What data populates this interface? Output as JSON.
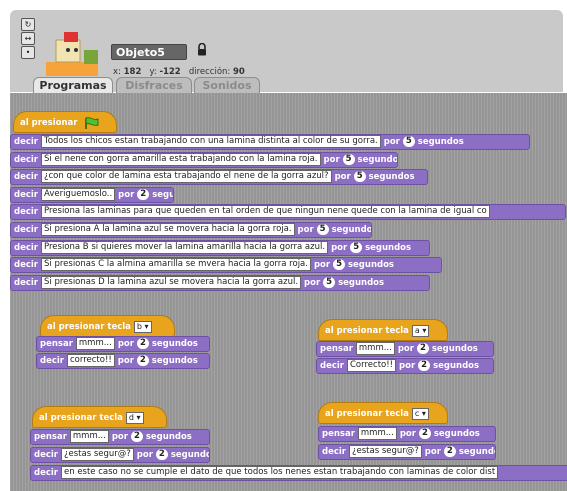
{
  "header": {
    "object_name": "Objeto5",
    "x_label": "x:",
    "x_value": "182",
    "y_label": "y:",
    "y_value": "-122",
    "direction_label": "dirección:",
    "direction_value": "90"
  },
  "tabs": [
    "Programas",
    "Disfraces",
    "Sonidos"
  ],
  "script_main": {
    "hat_label": "al presionar",
    "blocks": [
      {
        "cmd": "decir",
        "text": "Todos los chicos estan trabajando con una lamina distinta al color de su gorra.",
        "por": "por",
        "secs": "5",
        "unit": "segundos"
      },
      {
        "cmd": "decir",
        "text": "Si el nene con gorra amarilla esta trabajando con la lamina roja.",
        "por": "por",
        "secs": "5",
        "unit": "segundos"
      },
      {
        "cmd": "decir",
        "text": "¿con que color de lamina esta trabajando el nene de la gorra azul?",
        "por": "por",
        "secs": "5",
        "unit": "segundos"
      },
      {
        "cmd": "decir",
        "text": "Averiguemoslo..",
        "por": "por",
        "secs": "2",
        "unit": "segundos"
      },
      {
        "cmd": "decir",
        "text": "Presiona las laminas para que queden en tal orden de que ningun nene quede con la lamina de igual co",
        "por": "",
        "secs": "",
        "unit": ""
      },
      {
        "cmd": "decir",
        "text": "Si presiona A la lamina azul se movera hacia la gorra roja.",
        "por": "por",
        "secs": "5",
        "unit": "segundos"
      },
      {
        "cmd": "decir",
        "text": "Presiona B si quieres mover la lamina amarilla hacia la gorra azul.",
        "por": "por",
        "secs": "5",
        "unit": "segundos"
      },
      {
        "cmd": "decir",
        "text": "Si presionas C la almina amarilla se mvera hacia la gorra roja.",
        "por": "por",
        "secs": "5",
        "unit": "segundos"
      },
      {
        "cmd": "decir",
        "text": "Si presionas D la lamina azul se movera hacia la gorra azul.",
        "por": "por",
        "secs": "5",
        "unit": "segundos"
      }
    ]
  },
  "script_b": {
    "hat_label": "al presionar tecla",
    "key": "b",
    "think": {
      "cmd": "pensar",
      "text": "mmm...",
      "por": "por",
      "secs": "2",
      "unit": "segundos"
    },
    "say": {
      "cmd": "decir",
      "text": "correcto!!",
      "por": "por",
      "secs": "2",
      "unit": "segundos"
    }
  },
  "script_a": {
    "hat_label": "al presionar tecla",
    "key": "a",
    "think": {
      "cmd": "pensar",
      "text": "mmm...",
      "por": "por",
      "secs": "2",
      "unit": "segundos"
    },
    "say": {
      "cmd": "decir",
      "text": "Correcto!!",
      "por": "por",
      "secs": "2",
      "unit": "segundos"
    }
  },
  "script_d": {
    "hat_label": "al presionar tecla",
    "key": "d",
    "think": {
      "cmd": "pensar",
      "text": "mmm...",
      "por": "por",
      "secs": "2",
      "unit": "segundos"
    },
    "say": {
      "cmd": "decir",
      "text": "¿estas segur@?",
      "por": "por",
      "secs": "2",
      "unit": "segundos"
    },
    "say2": {
      "cmd": "decir",
      "text": "en este caso no se cumple el dato de que todos los nenes estan trabajando con laminas de color dist"
    }
  },
  "script_c": {
    "hat_label": "al presionar tecla",
    "key": "c",
    "think": {
      "cmd": "pensar",
      "text": "mmm...",
      "por": "por",
      "secs": "2",
      "unit": "segundos"
    },
    "say": {
      "cmd": "decir",
      "text": "¿estas segur@?",
      "por": "por",
      "secs": "2",
      "unit": "segundos"
    }
  }
}
